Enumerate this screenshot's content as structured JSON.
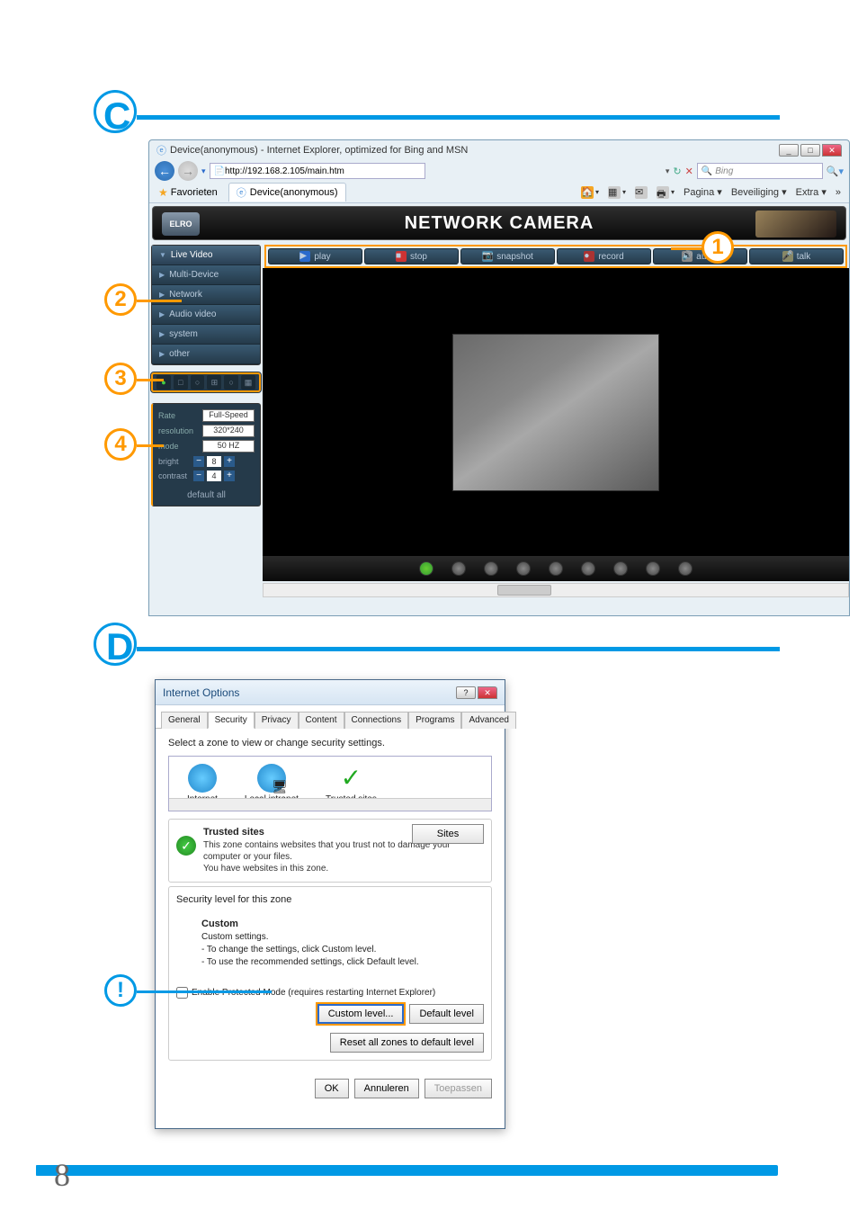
{
  "page": {
    "number": "8"
  },
  "sections": {
    "c": {
      "label": "C"
    },
    "d": {
      "label": "D"
    }
  },
  "callouts": {
    "c1": "1",
    "c2": "2",
    "c3": "3",
    "c4": "4",
    "d_warn": "!"
  },
  "ie": {
    "title": "Device(anonymous) - Internet Explorer, optimized for Bing and MSN",
    "url": "http://192.168.2.105/main.htm",
    "search_placeholder": "Bing",
    "favorites_label": "Favorieten",
    "tab_label": "Device(anonymous)",
    "cmdbar": {
      "pagina": "Pagina ▾",
      "beveiliging": "Beveiliging ▾",
      "extra": "Extra ▾",
      "more": "»"
    }
  },
  "camera": {
    "logo": "ELRO",
    "title_label": "NETWORK CAMERA",
    "sidebar": {
      "items": [
        "Live Video",
        "Multi-Device",
        "Network",
        "Audio video",
        "system",
        "other"
      ]
    },
    "controls": {
      "play": "play",
      "stop": "stop",
      "snapshot": "snapshot",
      "record": "record",
      "audio": "audio",
      "talk": "talk"
    },
    "settings": {
      "rate_label": "Rate",
      "rate_value": "Full-Speed",
      "resolution_label": "resolution",
      "resolution_value": "320*240",
      "mode_label": "mode",
      "mode_value": "50 HZ",
      "bright_label": "bright",
      "bright_value": "8",
      "contrast_label": "contrast",
      "contrast_value": "4",
      "default_label": "default all"
    }
  },
  "dialog": {
    "title": "Internet Options",
    "tabs": [
      "General",
      "Security",
      "Privacy",
      "Content",
      "Connections",
      "Programs",
      "Advanced"
    ],
    "active_tab": "Security",
    "zone_prompt": "Select a zone to view or change security settings.",
    "zones": [
      "Internet",
      "Local intranet",
      "Trusted sites"
    ],
    "trusted": {
      "title": "Trusted sites",
      "desc1": "This zone contains websites that you trust not to damage your computer or your files.",
      "desc2": "You have websites in this zone.",
      "sites_btn": "Sites"
    },
    "level": {
      "title": "Security level for this zone",
      "custom_label": "Custom",
      "settings_label": "Custom settings.",
      "change_hint": "- To change the settings, click Custom level.",
      "default_hint": "- To use the recommended settings, click Default level."
    },
    "protected_label": "Enable Protected Mode (requires restarting Internet Explorer)",
    "custom_level_btn": "Custom level...",
    "default_level_btn": "Default level",
    "reset_btn": "Reset all zones to default level",
    "ok_btn": "OK",
    "cancel_btn": "Annuleren",
    "apply_btn": "Toepassen"
  }
}
